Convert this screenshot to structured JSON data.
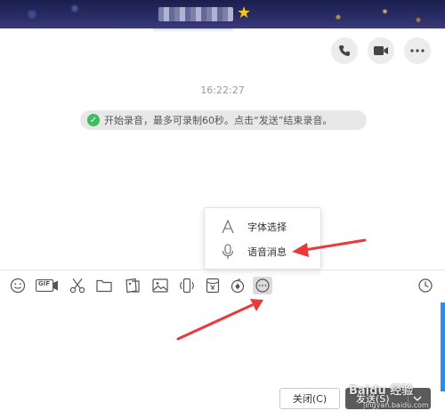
{
  "header": {
    "star_icon": "star-icon"
  },
  "top_actions": {
    "icons": [
      "phone-icon",
      "video-icon",
      "more-icon"
    ]
  },
  "chat": {
    "timestamp": "16:22:27",
    "notice_text": "开始录音，最多可录制60秒。点击“发送”结束录音。"
  },
  "popup_menu": {
    "items": [
      {
        "label": "字体选择",
        "icon": "font-icon"
      },
      {
        "label": "语音消息",
        "icon": "microphone-icon"
      }
    ]
  },
  "toolbar": {
    "gif_label": "GIF",
    "icons": [
      "emoji-icon",
      "gif-icon",
      "scissors-icon",
      "folder-icon",
      "gallery-icon",
      "image-icon",
      "shake-icon",
      "red-packet-icon",
      "gift-icon",
      "more-icon",
      "history-icon"
    ]
  },
  "footer": {
    "close_label": "关闭(C)",
    "send_label": "发送(S)",
    "watermark": "Baidu 经验",
    "watermark_url": "jingyan.baidu.com"
  },
  "colors": {
    "accent_red": "#e83a3a",
    "check_green": "#3dbd5d",
    "scroll_blue": "#2d8ee6"
  }
}
